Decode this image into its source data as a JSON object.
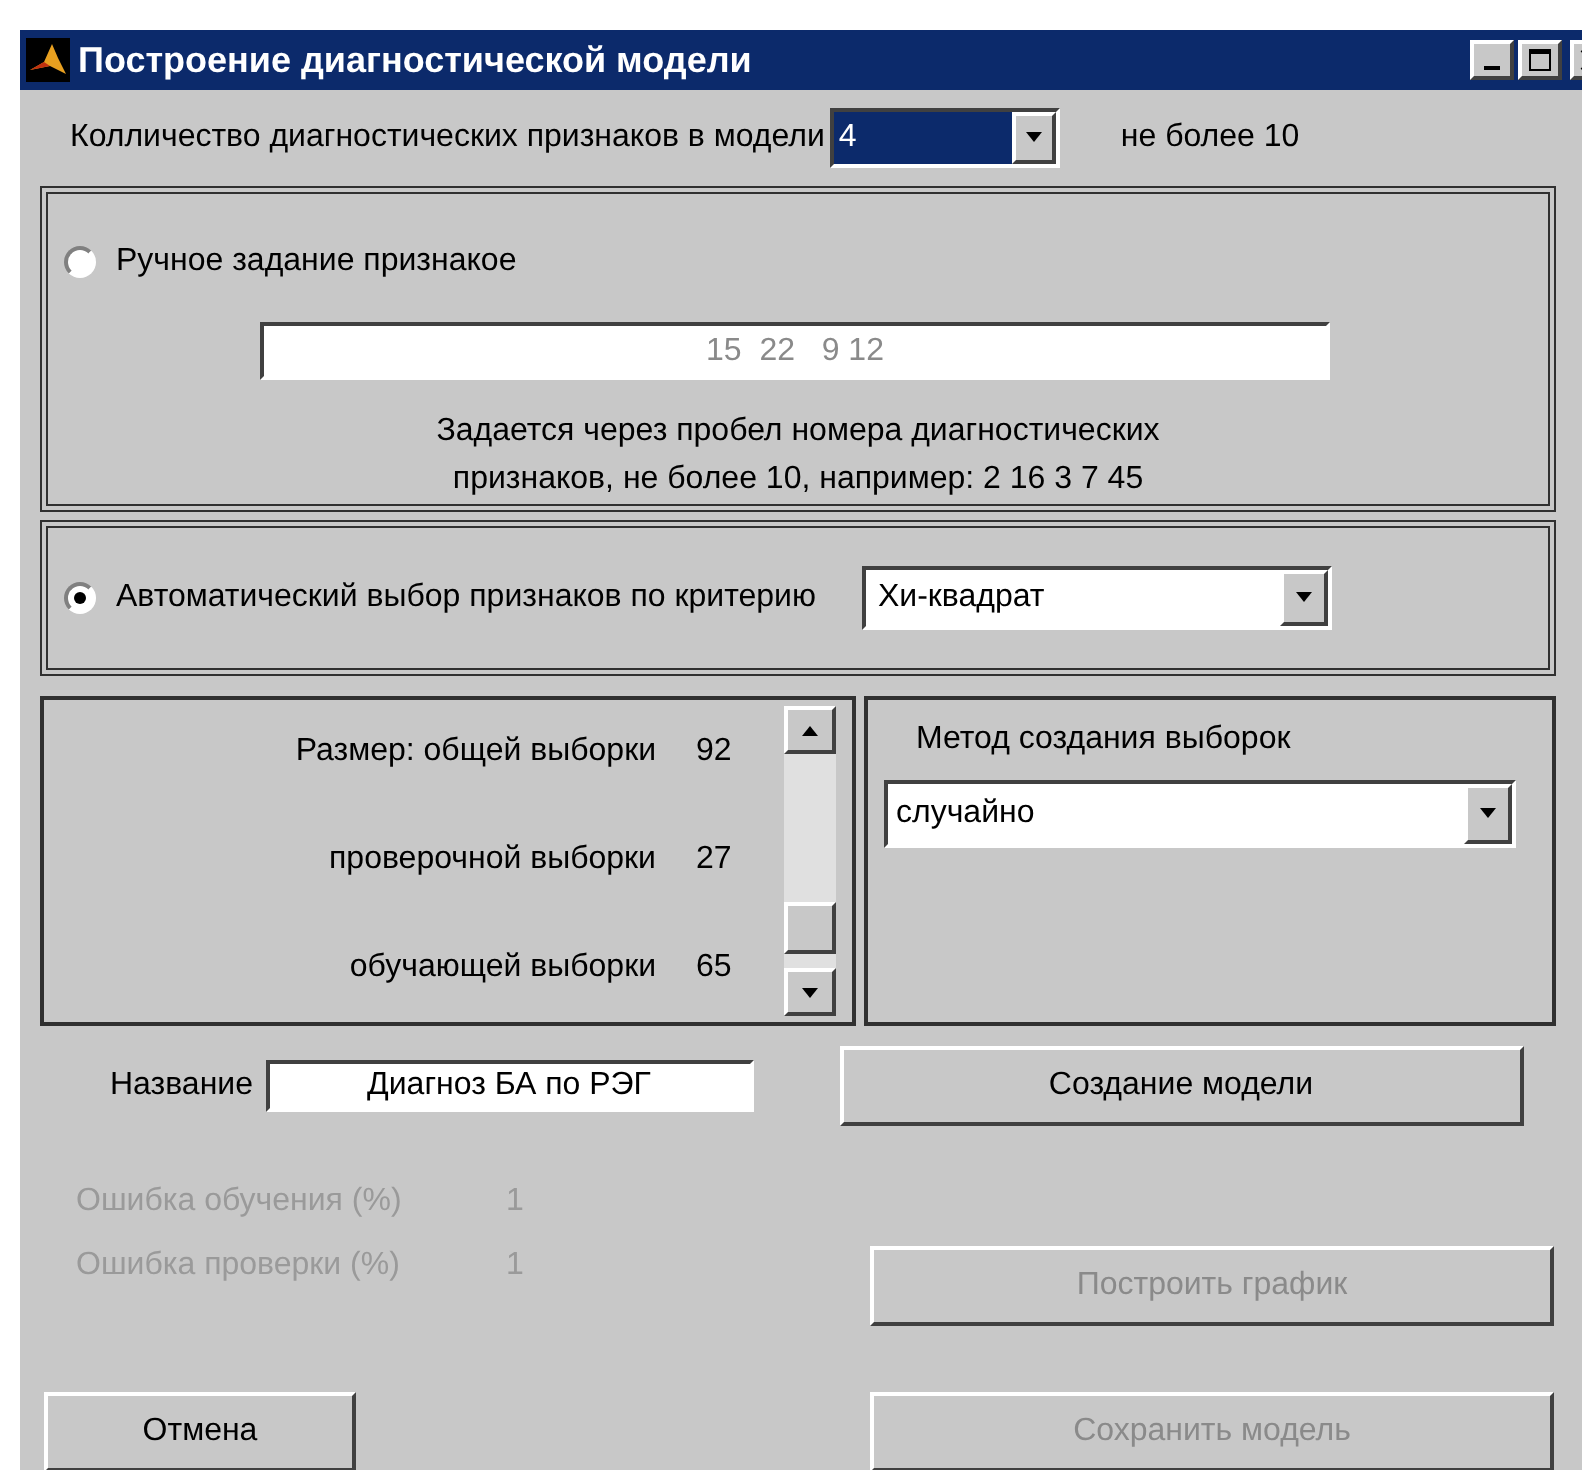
{
  "window": {
    "title": "Построение диагностической модели"
  },
  "feature_count": {
    "label": "Колличество диагностических признаков в модели",
    "value": "4",
    "note": "не более 10"
  },
  "selection_modes": [
    {
      "kind": "manual",
      "label": "Ручное задание признакое",
      "selected": false,
      "field_value": "15  22   9 12",
      "hint_lines": [
        "Задается через пробел номера диагностических",
        "признаков, не более 10, например: 2 16 3 7 45"
      ]
    },
    {
      "kind": "auto",
      "label": "Автоматический выбор признаков по критерию",
      "selected": true,
      "criterion": "Хи-квадрат"
    }
  ],
  "sample_sizes": [
    {
      "label": "Размер: общей выборки",
      "value": "92"
    },
    {
      "label": "проверочной выборки",
      "value": "27"
    },
    {
      "label": "обучающей выборки",
      "value": "65"
    }
  ],
  "sampling_method": {
    "label": "Метод создания выборок",
    "value": "случайно"
  },
  "model_name": {
    "label": "Название",
    "value": "Диагноз БА по РЭГ"
  },
  "errors": [
    {
      "label": "Ошибка обучения (%)",
      "value": "1",
      "disabled": true
    },
    {
      "label": "Ошибка проверки (%)",
      "value": "1",
      "disabled": true
    }
  ],
  "buttons": [
    {
      "label": "Создание модели",
      "disabled": false
    },
    {
      "label": "Построить график",
      "disabled": true
    },
    {
      "label": "Отмена",
      "disabled": false
    },
    {
      "label": "Сохранить модель",
      "disabled": true
    }
  ]
}
